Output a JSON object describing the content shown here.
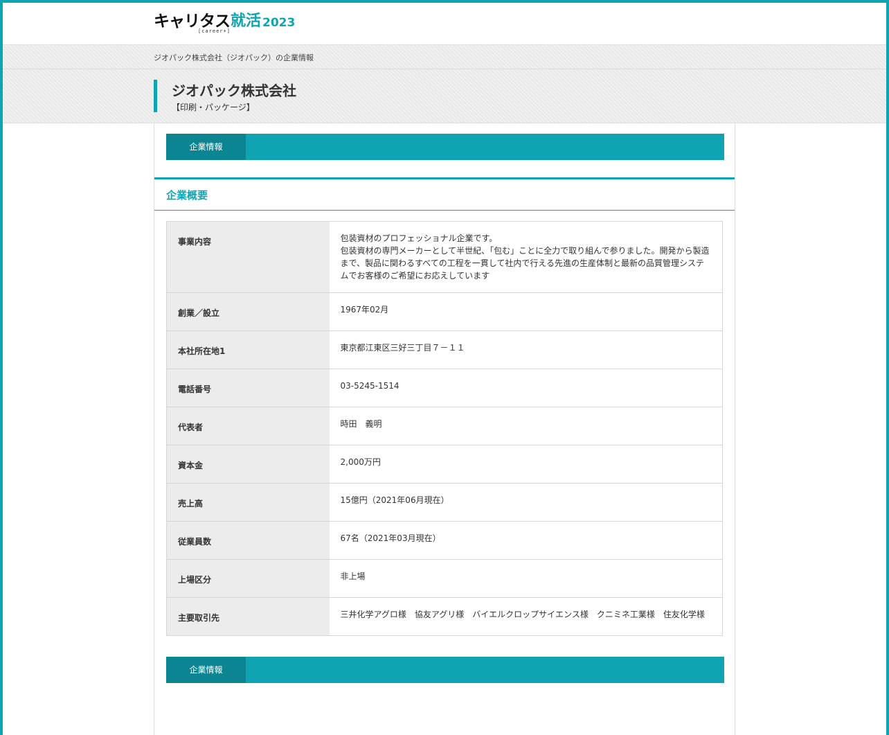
{
  "header": {
    "logo_main": "キャリタス",
    "logo_accent": "就活",
    "logo_year": "2023",
    "logo_sub": "[career+]"
  },
  "breadcrumb": "ジオパック株式会社（ジオパック）の企業情報",
  "company": {
    "name": "ジオパック株式会社",
    "industry": "【印刷・パッケージ】"
  },
  "tabs": {
    "top_label": "企業情報",
    "bottom_label": "企業情報"
  },
  "section": {
    "heading": "企業概要"
  },
  "overview": {
    "business_label": "事業内容",
    "business_lines": [
      "包装資材のプロフェッショナル企業です。",
      "包装資材の専門メーカーとして半世紀、「包む」ことに全力で取り組んで参りました。開発から製造まで、製品に関わるすべての工程を一貫して社内で行える先進の生産体制と最新の品質管理システムでお客様のご希望にお応えしています"
    ],
    "founded_label": "創業／設立",
    "founded": "1967年02月",
    "address_label": "本社所在地1",
    "address": "東京都江東区三好三丁目７－１１",
    "phone_label": "電話番号",
    "phone": "03-5245-1514",
    "rep_label": "代表者",
    "rep": "時田　義明",
    "capital_label": "資本金",
    "capital": "2,000万円",
    "sales_label": "売上高",
    "sales": "15億円（2021年06月現在）",
    "employees_label": "従業員数",
    "employees": "67名（2021年03月現在）",
    "listing_label": "上場区分",
    "listing": "非上場",
    "clients_label": "主要取引先",
    "clients": "三井化学アグロ様　協友アグリ様　バイエルクロップサイエンス様　クニミネ工業様　住友化学様"
  },
  "colors": {
    "accent": "#10a3b1",
    "tab_active": "#0b8592",
    "band": "#ececec"
  }
}
